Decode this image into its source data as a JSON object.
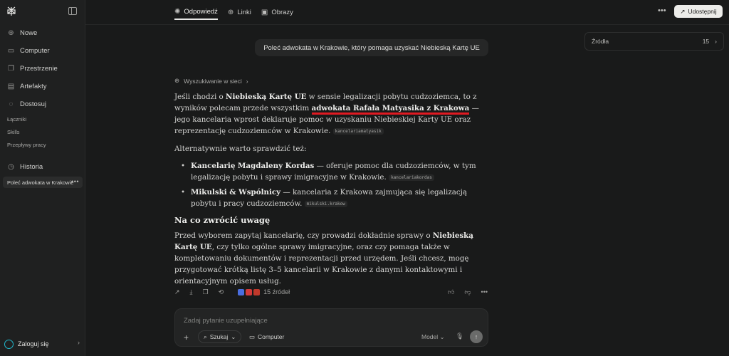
{
  "sidebar": {
    "items": [
      {
        "icon": "plus-icon",
        "label": "Nowe"
      },
      {
        "icon": "monitor-icon",
        "label": "Computer"
      },
      {
        "icon": "spaces-icon",
        "label": "Przestrzenie"
      },
      {
        "icon": "artifact-icon",
        "label": "Artefakty"
      },
      {
        "icon": "customize-icon",
        "label": "Dostosuj"
      }
    ],
    "sub_items": [
      "Łączniki",
      "Skills",
      "Przepływy pracy"
    ],
    "history_label": "Historia",
    "thread_title": "Poleć adwokata w Krakowie",
    "thread_more": "•••",
    "login_label": "Zaloguj się"
  },
  "header": {
    "tabs": [
      {
        "icon": "answer-icon",
        "label": "Odpowiedź",
        "active": true
      },
      {
        "icon": "globe-icon",
        "label": "Linki"
      },
      {
        "icon": "image-icon",
        "label": "Obrazy"
      }
    ],
    "more": "•••",
    "share_label": "Udostępnij"
  },
  "sources_panel": {
    "label": "Źródła",
    "count": "15"
  },
  "query": "Poleć adwokata w Krakowie, który pomaga uzyskać Niebieską Kartę UE",
  "search_step": "Wyszukiwanie w sieci",
  "answer": {
    "p1_a": "Jeśli chodzi o ",
    "p1_b": "Niebieską Kartę UE",
    "p1_c": " w sensie legalizacji pobytu cudzoziemca, to z wyników polecam przede wszystkim ",
    "p1_d": "adwokata Rafała Matyasika z Krakowa",
    "p1_e": " — jego kancelaria wprost deklaruje pomoc w uzyskaniu Niebieskiej Karty UE oraz reprezentację cudzoziemców w Krakowie.",
    "p1_chip": "kancelariamatyasik",
    "alt_intro": "Alternatywnie warto sprawdzić też:",
    "alt": [
      {
        "name": "Kancelarię Magdaleny Kordas",
        "text": " — oferuje pomoc dla cudzoziemców, w tym legalizację pobytu i sprawy imigracyjne w Krakowie.",
        "chip": "kancelariakordas"
      },
      {
        "name": "Mikulski & Wspólnicy",
        "text": " — kancelaria z Krakowa zajmująca się legalizacją pobytu i pracy cudzoziemców.",
        "chip": "mikulski.krakow"
      }
    ],
    "heading": "Na co zwrócić uwagę",
    "p2_a": "Przed wyborem zapytaj kancelarię, czy prowadzi dokładnie sprawy o ",
    "p2_b": "Niebieską Kartę UE",
    "p2_c": ", czy tylko ogólne sprawy imigracyjne, oraz czy pomaga także w kompletowaniu dokumentów i reprezentacji przed urzędem. Jeśli chcesz, mogę przygotować krótką listę 3–5 kancelarii w Krakowie z danymi kontaktowymi i orientacyjnym opisem usług."
  },
  "actions": {
    "sources_label": "15 źródeł",
    "more": "•••"
  },
  "composer": {
    "placeholder": "Zadaj pytanie uzupełniające",
    "search_label": "Szukaj",
    "computer_label": "Computer",
    "model_label": "Model"
  },
  "colors": {
    "accent": "#20b8cd",
    "underline": "#e01a22"
  }
}
